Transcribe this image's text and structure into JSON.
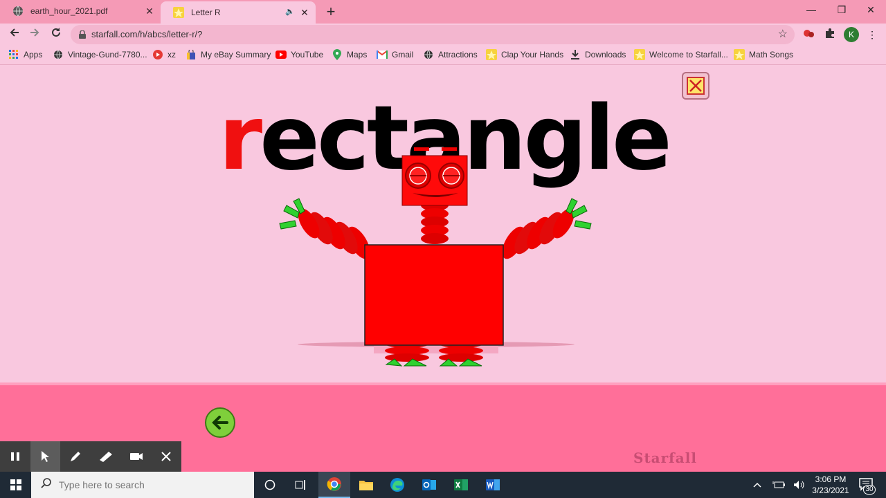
{
  "tabs": [
    {
      "title": "earth_hour_2021.pdf",
      "icon": "globe-icon"
    },
    {
      "title": "Letter R",
      "icon": "starfall-star-icon"
    }
  ],
  "window_controls": {
    "minimize": "—",
    "restore": "❐",
    "close": "✕"
  },
  "toolbar": {
    "url": "starfall.com/h/abcs/letter-r/?",
    "avatar_letter": "K"
  },
  "bookmarks": [
    {
      "label": "Apps",
      "icon": "apps-grid-icon"
    },
    {
      "label": "Vintage-Gund-7780...",
      "icon": "globe-icon"
    },
    {
      "label": "xz",
      "icon": "play-red-icon"
    },
    {
      "label": "My eBay Summary",
      "icon": "shopping-bag-icon"
    },
    {
      "label": "YouTube",
      "icon": "youtube-icon"
    },
    {
      "label": "Maps",
      "icon": "maps-pin-icon"
    },
    {
      "label": "Gmail",
      "icon": "gmail-icon"
    },
    {
      "label": "Attractions",
      "icon": "globe-icon"
    },
    {
      "label": "Clap Your Hands",
      "icon": "starfall-star-icon"
    },
    {
      "label": "Downloads",
      "icon": "download-icon"
    },
    {
      "label": "Welcome to Starfall...",
      "icon": "starfall-star-icon"
    },
    {
      "label": "Math Songs",
      "icon": "starfall-star-icon"
    }
  ],
  "content": {
    "word_first_letter": "r",
    "word_rest": "ectangle",
    "logo_text": "Starfall"
  },
  "colors": {
    "accent_red": "#f01010",
    "page_pink": "#f9c8df",
    "band_pink": "#ff6f99",
    "taskbar": "#1f2a36"
  },
  "taskbar": {
    "search_placeholder": "Type here to search",
    "time": "3:06 PM",
    "date": "3/23/2021",
    "notification_count": "30"
  }
}
